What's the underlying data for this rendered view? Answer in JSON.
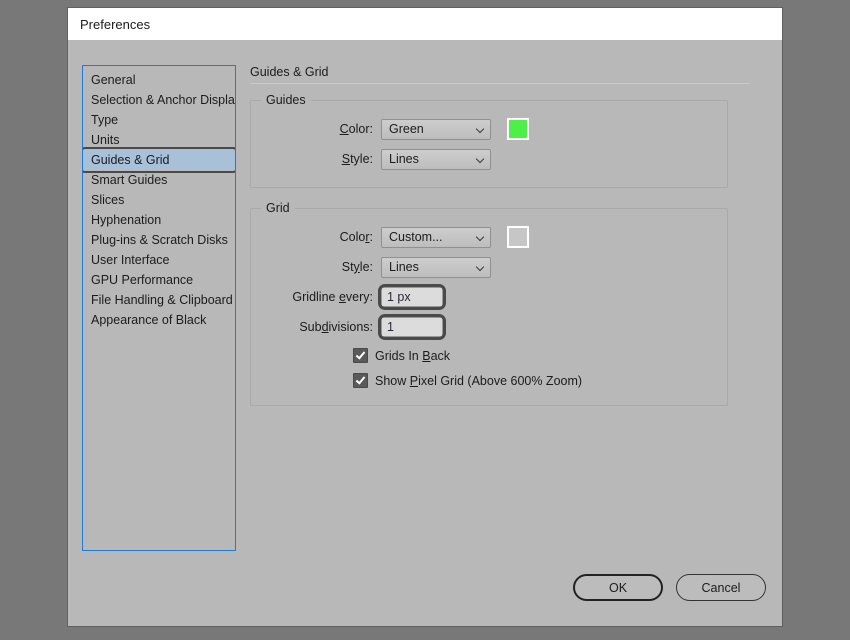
{
  "window": {
    "title": "Preferences"
  },
  "sidebar": {
    "items": [
      {
        "label": "General",
        "selected": false
      },
      {
        "label": "Selection & Anchor Display",
        "selected": false
      },
      {
        "label": "Type",
        "selected": false
      },
      {
        "label": "Units",
        "selected": false
      },
      {
        "label": "Guides & Grid",
        "selected": true
      },
      {
        "label": "Smart Guides",
        "selected": false
      },
      {
        "label": "Slices",
        "selected": false
      },
      {
        "label": "Hyphenation",
        "selected": false
      },
      {
        "label": "Plug-ins & Scratch Disks",
        "selected": false
      },
      {
        "label": "User Interface",
        "selected": false
      },
      {
        "label": "GPU Performance",
        "selected": false
      },
      {
        "label": "File Handling & Clipboard",
        "selected": false
      },
      {
        "label": "Appearance of Black",
        "selected": false
      }
    ]
  },
  "panel": {
    "header": "Guides & Grid",
    "guides": {
      "legend": "Guides",
      "color_label": "Color:",
      "color_value": "Green",
      "color_swatch": "#4cf046",
      "style_label": "Style:",
      "style_value": "Lines"
    },
    "grid": {
      "legend": "Grid",
      "color_label": "Color:",
      "color_value": "Custom...",
      "color_swatch": "#c6c6c6",
      "style_label": "Style:",
      "style_value": "Lines",
      "gridline_label": "Gridline every:",
      "gridline_value": "1 px",
      "subdivisions_label": "Subdivisions:",
      "subdivisions_value": "1",
      "grids_in_back_label": "Grids In Back",
      "show_pixel_grid_label": "Show Pixel Grid (Above 600% Zoom)"
    }
  },
  "footer": {
    "ok_label": "OK",
    "cancel_label": "Cancel"
  }
}
